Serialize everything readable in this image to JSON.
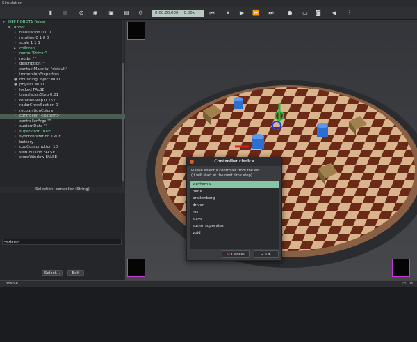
{
  "window": {
    "title": "Simulation"
  },
  "toolbar": {
    "time": "0:00:00:000",
    "speed": "0.00x",
    "icons": [
      "panel-icon",
      "blank-icon",
      "target-icon",
      "eye-icon",
      "save-icon",
      "reload-icon",
      "step-back-icon",
      "pause-icon",
      "play-icon",
      "fast-forward-icon",
      "fastest-icon",
      "record-icon",
      "video-icon",
      "camera-icon",
      "volume-icon"
    ]
  },
  "tree": {
    "rows": [
      {
        "text": "DEF ROBOT1 Robot",
        "indent": 0,
        "marker": "▾",
        "style": "green"
      },
      {
        "text": "Robot",
        "indent": 1,
        "marker": "▾",
        "style": "green"
      },
      {
        "text": "translation 0 0 0",
        "indent": 2,
        "marker": "•",
        "style": ""
      },
      {
        "text": "rotation 0 1 0 0",
        "indent": 2,
        "marker": "•",
        "style": ""
      },
      {
        "text": "scale 1 1 1",
        "indent": 2,
        "marker": "•",
        "style": ""
      },
      {
        "text": "children",
        "indent": 2,
        "marker": "▸",
        "style": "green"
      },
      {
        "text": "name \"Driver\"",
        "indent": 2,
        "marker": "•",
        "style": "green"
      },
      {
        "text": "model \"\"",
        "indent": 2,
        "marker": "•",
        "style": ""
      },
      {
        "text": "description \"\"",
        "indent": 2,
        "marker": "•",
        "style": ""
      },
      {
        "text": "contactMaterial \"default\"",
        "indent": 2,
        "marker": "•",
        "style": ""
      },
      {
        "text": "immersionProperties",
        "indent": 2,
        "marker": "•",
        "style": ""
      },
      {
        "text": "boundingObject NULL",
        "indent": 2,
        "marker": "●",
        "style": ""
      },
      {
        "text": "physics NULL",
        "indent": 2,
        "marker": "●",
        "style": ""
      },
      {
        "text": "locked FALSE",
        "indent": 2,
        "marker": "•",
        "style": ""
      },
      {
        "text": "translationStep 0.01",
        "indent": 2,
        "marker": "•",
        "style": ""
      },
      {
        "text": "rotationStep 0.262",
        "indent": 2,
        "marker": "•",
        "style": ""
      },
      {
        "text": "radarCrossSection 0",
        "indent": 2,
        "marker": "•",
        "style": ""
      },
      {
        "text": "recognitionColors",
        "indent": 2,
        "marker": "•",
        "style": ""
      },
      {
        "text": "controller \"<extern>\"",
        "indent": 2,
        "marker": "•",
        "style": "sel"
      },
      {
        "text": "controllerArgs \"\"",
        "indent": 2,
        "marker": "•",
        "style": ""
      },
      {
        "text": "customData \"\"",
        "indent": 2,
        "marker": "•",
        "style": ""
      },
      {
        "text": "supervisor TRUE",
        "indent": 2,
        "marker": "•",
        "style": "green"
      },
      {
        "text": "synchronization TRUE",
        "indent": 2,
        "marker": "•",
        "style": ""
      },
      {
        "text": "battery",
        "indent": 2,
        "marker": "•",
        "style": ""
      },
      {
        "text": "cpuConsumption 10",
        "indent": 2,
        "marker": "•",
        "style": ""
      },
      {
        "text": "selfCollision FALSE",
        "indent": 2,
        "marker": "•",
        "style": ""
      },
      {
        "text": "showWindow FALSE",
        "indent": 2,
        "marker": "•",
        "style": ""
      }
    ]
  },
  "field_editor": {
    "title": "Selection: controller (String)",
    "value": "<extern>",
    "select_label": "Select...",
    "edit_label": "Edit"
  },
  "dialog": {
    "title": "Controller choice",
    "prompt_line1": "Please select a controller from the list",
    "prompt_line2": "(it will start at the next time step)",
    "items": [
      "<extern>",
      "none",
      "braitenberg",
      "driver",
      "ros",
      "slave",
      "sumo_supervisor",
      "void"
    ],
    "selected_index": 0,
    "cancel_label": "Cancel",
    "ok_label": "OK"
  },
  "console": {
    "title": "Console"
  },
  "colors": {
    "accent": "#86c6a6",
    "corner_border": "#c53ad8",
    "board_dark": "#6b2a18",
    "board_light": "#d9b48c"
  }
}
